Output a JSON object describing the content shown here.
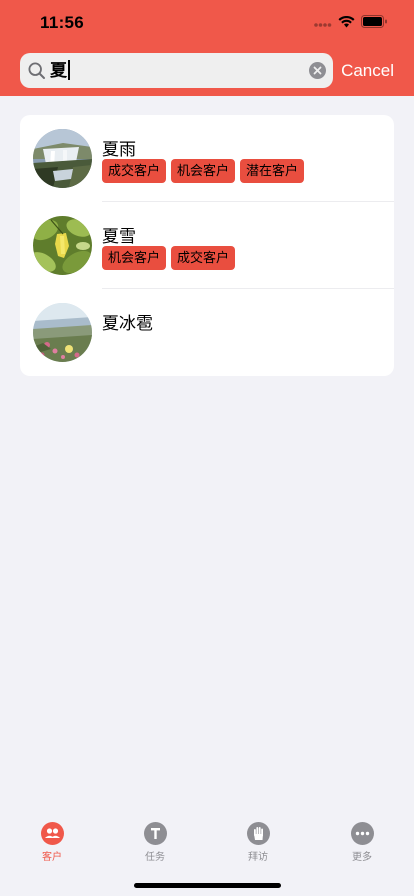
{
  "status_bar": {
    "time": "11:56"
  },
  "search": {
    "query": "夏",
    "cancel_label": "Cancel"
  },
  "results": [
    {
      "name": "夏雨",
      "tags": [
        "成交客户",
        "机会客户",
        "潜在客户"
      ],
      "avatar": "waterfall-photo"
    },
    {
      "name": "夏雪",
      "tags": [
        "机会客户",
        "成交客户"
      ],
      "avatar": "green-leaves-photo"
    },
    {
      "name": "夏冰雹",
      "tags": [],
      "avatar": "flowers-coast-photo"
    }
  ],
  "tab_bar": {
    "tabs": [
      {
        "label": "客户",
        "icon": "people-icon",
        "active": true
      },
      {
        "label": "任务",
        "icon": "task-t-icon",
        "active": false
      },
      {
        "label": "拜访",
        "icon": "hand-icon",
        "active": false
      },
      {
        "label": "更多",
        "icon": "more-dots-icon",
        "active": false
      }
    ]
  },
  "colors": {
    "accent": "#f0584a",
    "tag": "#e94e3f",
    "background": "#f2f2f7",
    "inactive": "#8e8e93"
  }
}
